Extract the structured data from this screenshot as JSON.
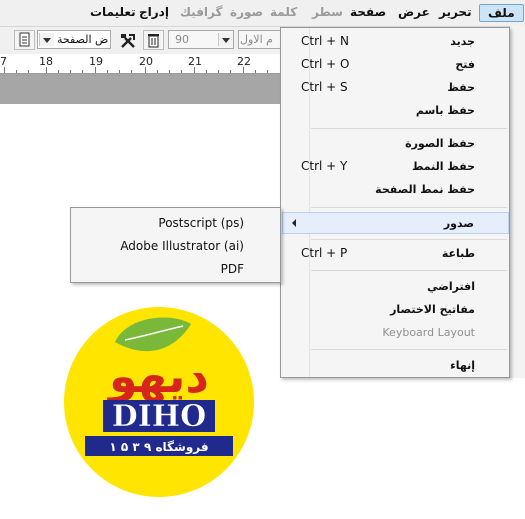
{
  "menubar": {
    "items": [
      {
        "label": "ملف",
        "state": "active"
      },
      {
        "label": "تحرير",
        "state": "normal"
      },
      {
        "label": "عرض",
        "state": "normal"
      },
      {
        "label": "صفحة",
        "state": "normal"
      },
      {
        "label": "سطر",
        "state": "disabled"
      },
      {
        "label": "كلمة",
        "state": "disabled"
      },
      {
        "label": "صورة",
        "state": "disabled"
      },
      {
        "label": "گرافيك",
        "state": "disabled"
      },
      {
        "label": "إدراج",
        "state": "normal"
      },
      {
        "label": "تعليمات",
        "state": "normal"
      }
    ]
  },
  "toolbar": {
    "page_combo_value": "ض الصفحة",
    "zoom_value": "90",
    "style_combo_value": "م الاول"
  },
  "ruler": {
    "labels": [
      "7",
      "18",
      "19",
      "20",
      "21",
      "22"
    ]
  },
  "file_menu": {
    "items": [
      {
        "label": "جديد",
        "shortcut": "Ctrl + N"
      },
      {
        "label": "فتح",
        "shortcut": "Ctrl + O"
      },
      {
        "label": "حفظ",
        "shortcut": "Ctrl + S"
      },
      {
        "label": "حفظ باسم",
        "shortcut": ""
      },
      {
        "label": "حفظ الصورة",
        "shortcut": ""
      },
      {
        "label": "حفظ النمط",
        "shortcut": "Ctrl + Y"
      },
      {
        "label": "حفظ نمط الصفحة",
        "shortcut": ""
      },
      {
        "label": "صدور",
        "shortcut": ""
      },
      {
        "label": "طباعة",
        "shortcut": "Ctrl + P"
      },
      {
        "label": "افتراضي",
        "shortcut": ""
      },
      {
        "label": "مفاتيح الاختصار",
        "shortcut": ""
      },
      {
        "label": "Keyboard Layout",
        "shortcut": ""
      },
      {
        "label": "إنهاء",
        "shortcut": ""
      }
    ]
  },
  "export_submenu": {
    "items": [
      "Postscript (ps)",
      "Adobe Illustrator (ai)",
      "PDF"
    ]
  },
  "logo": {
    "brand_latin": "DIHO",
    "brand_arabic": "دیهو",
    "tagline": "فروشگاه ۹ ۳ ۵ ۱",
    "colors": {
      "circle": "#ffe500",
      "red": "#d6261c",
      "navy": "#1f2a8c",
      "leaf": "#7ab83a"
    }
  }
}
